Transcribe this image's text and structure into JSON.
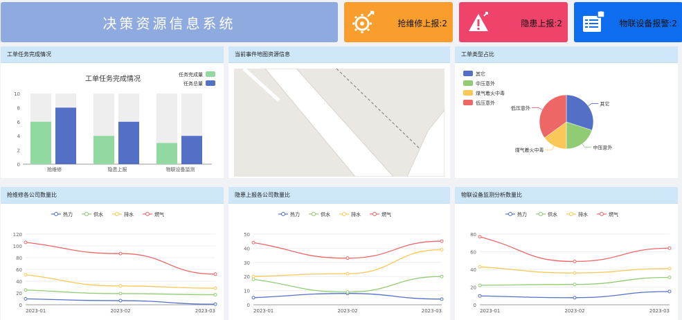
{
  "header": {
    "title": "决策资源信息系统"
  },
  "alerts": {
    "repair": "抢维修上报:2",
    "hazard": "隐患上报:2",
    "iot": "物联设备报警:2"
  },
  "panels": {
    "task": "工单任务完成情况",
    "map": "当前事件地图资源信息",
    "type": "工单类型占比",
    "repair_company": "抢维修各公司数量比",
    "hazard_company": "隐患上报各公司数量比",
    "iot_analysis": "物联设备监测分析数量比"
  },
  "colors": {
    "heat": "#5470c6",
    "water": "#91cc75",
    "drain": "#fac858",
    "gas": "#ee6666",
    "bg_done": "#91d9a0",
    "bg_total": "#5470c6",
    "bar_bg": "#eeeeee"
  },
  "chart_data": [
    {
      "type": "bar",
      "title": "工单任务完成情况",
      "categories": [
        "抢维修",
        "隐患上报",
        "物联设备监测"
      ],
      "series": [
        {
          "name": "任务完成量",
          "values": [
            6,
            4,
            3
          ]
        },
        {
          "name": "任务总量",
          "values": [
            8,
            6,
            4
          ]
        }
      ],
      "ylim": [
        0,
        10
      ],
      "yticks": [
        "0",
        "2",
        "4",
        "6",
        "8",
        "10"
      ],
      "legend": "top-right"
    },
    {
      "type": "pie",
      "labels": [
        "其它",
        "中压意外",
        "煤气着火中毒",
        "低压意外"
      ],
      "values": [
        30,
        20,
        15,
        35
      ],
      "legend": "top-left"
    },
    {
      "type": "line",
      "x": [
        "2023-01",
        "2023-02",
        "2023-03"
      ],
      "xticks": [
        "2023-01",
        "2023-02",
        "2023-03"
      ],
      "series": [
        {
          "name": "热力",
          "values": [
            10,
            7,
            1
          ]
        },
        {
          "name": "供水",
          "values": [
            25,
            19,
            17
          ]
        },
        {
          "name": "排水",
          "values": [
            51,
            32,
            28
          ]
        },
        {
          "name": "燃气",
          "values": [
            106,
            87,
            52
          ]
        }
      ],
      "ylim": [
        0,
        120
      ],
      "yticks": [
        "0",
        "20",
        "40",
        "60",
        "80",
        "100",
        "120"
      ],
      "legend": "top-center"
    },
    {
      "type": "line",
      "x": [
        "2023-01",
        "2023-02",
        "2023-03"
      ],
      "xticks": [
        "2023-01",
        "2023-02",
        "2023-03"
      ],
      "series": [
        {
          "name": "热力",
          "values": [
            5,
            8,
            4
          ]
        },
        {
          "name": "供水",
          "values": [
            18,
            9,
            20
          ]
        },
        {
          "name": "排水",
          "values": [
            20,
            22,
            39
          ]
        },
        {
          "name": "燃气",
          "values": [
            44,
            33,
            45
          ]
        }
      ],
      "ylim": [
        0,
        50
      ],
      "yticks": [
        "0",
        "10",
        "20",
        "30",
        "40",
        "50"
      ],
      "legend": "top-center"
    },
    {
      "type": "line",
      "x": [
        "2023-01",
        "2023-02",
        "2023-03"
      ],
      "xticks": [
        "2023-01",
        "2023-02",
        "2023-03"
      ],
      "series": [
        {
          "name": "热力",
          "values": [
            10,
            8,
            15
          ]
        },
        {
          "name": "供水",
          "values": [
            22,
            23,
            31
          ]
        },
        {
          "name": "排水",
          "values": [
            43,
            36,
            41
          ]
        },
        {
          "name": "燃气",
          "values": [
            77,
            49,
            64
          ]
        }
      ],
      "ylim": [
        0,
        80
      ],
      "yticks": [
        "0",
        "20",
        "40",
        "60",
        "80"
      ],
      "legend": "top-center"
    }
  ]
}
